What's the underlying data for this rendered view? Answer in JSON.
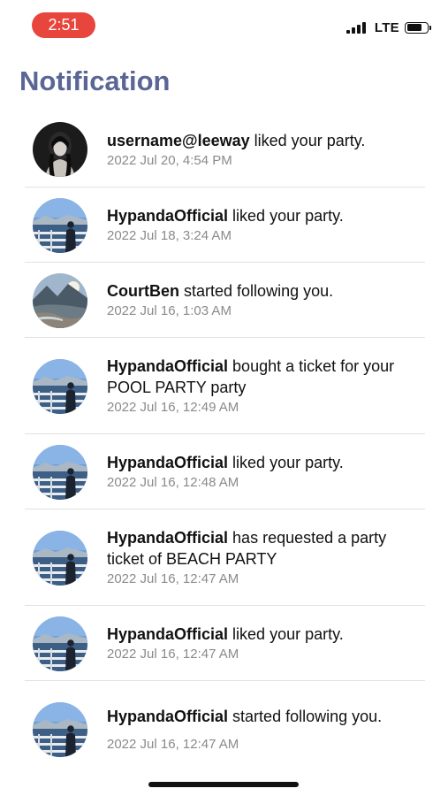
{
  "status_bar": {
    "time": "2:51",
    "network": "LTE"
  },
  "page": {
    "title": "Notification"
  },
  "notifications": [
    {
      "user": "username@leeway",
      "action": "liked your party.",
      "time": "2022 Jul 20, 4:54 PM",
      "avatar": "portrait-dark"
    },
    {
      "user": "HypandaOfficial",
      "action": "liked your party.",
      "time": "2022 Jul 18, 3:24 AM",
      "avatar": "seaside-person"
    },
    {
      "user": "CourtBen",
      "action": "started following you.",
      "time": "2022 Jul 16, 1:03 AM",
      "avatar": "mountain-landscape"
    },
    {
      "user": "HypandaOfficial",
      "action": "bought a ticket for your POOL PARTY party",
      "time": "2022 Jul 16, 12:49 AM",
      "avatar": "seaside-person"
    },
    {
      "user": "HypandaOfficial",
      "action": "liked your party.",
      "time": "2022 Jul 16, 12:48 AM",
      "avatar": "seaside-person"
    },
    {
      "user": "HypandaOfficial",
      "action": "has requested a party ticket of BEACH PARTY",
      "time": "2022 Jul 16, 12:47 AM",
      "avatar": "seaside-person"
    },
    {
      "user": "HypandaOfficial",
      "action": "liked your party.",
      "time": "2022 Jul 16, 12:47 AM",
      "avatar": "seaside-person"
    },
    {
      "user": "HypandaOfficial",
      "action": "started following you.",
      "time": "2022 Jul 16, 12:47 AM",
      "avatar": "seaside-person"
    }
  ],
  "colors": {
    "title": "#5a6695",
    "time_pill": "#e8453c",
    "timestamp": "#8a8a8e",
    "divider": "#e2e2e2"
  }
}
